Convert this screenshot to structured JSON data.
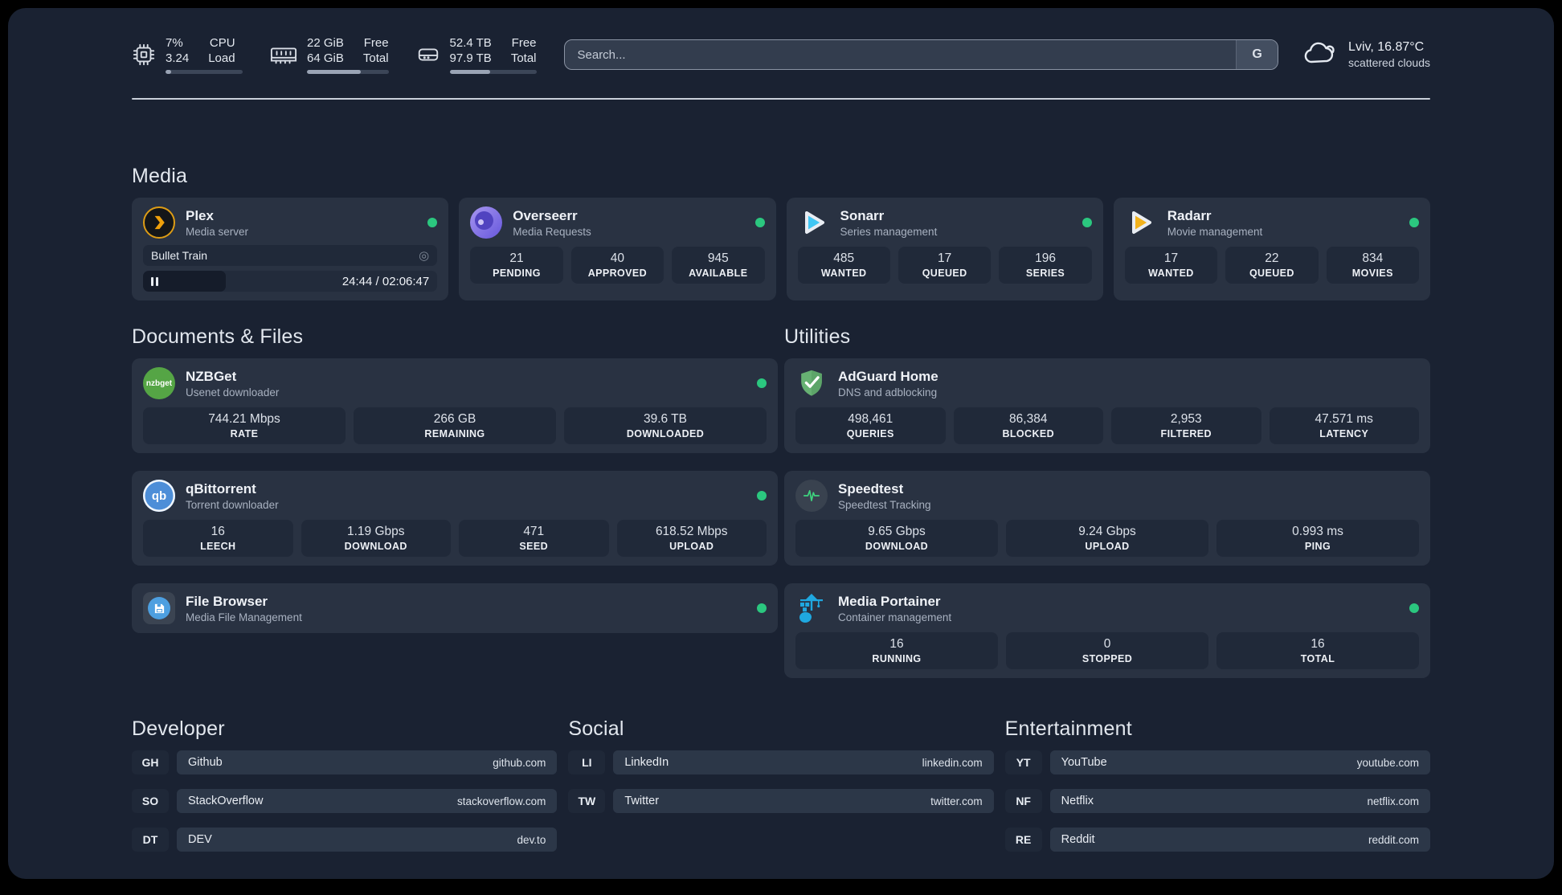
{
  "header": {
    "system_stats": [
      {
        "icon": "cpu-icon",
        "values": [
          "7%",
          "3.24"
        ],
        "labels": [
          "CPU",
          "Load"
        ],
        "progress_pct": 7
      },
      {
        "icon": "memory-icon",
        "values": [
          "22 GiB",
          "64 GiB"
        ],
        "labels": [
          "Free",
          "Total"
        ],
        "progress_pct": 66
      },
      {
        "icon": "disk-icon",
        "values": [
          "52.4 TB",
          "97.9 TB"
        ],
        "labels": [
          "Free",
          "Total"
        ],
        "progress_pct": 47
      }
    ],
    "search": {
      "placeholder": "Search...",
      "engine_label": "G"
    },
    "weather": {
      "location": "Lviv, 16.87°C",
      "condition": "scattered clouds"
    }
  },
  "colors": {
    "status_online": "#2bc77f"
  },
  "media": {
    "title": "Media",
    "plex": {
      "name": "Plex",
      "subtitle": "Media server",
      "online": true,
      "now_playing": {
        "title": "Bullet Train",
        "time_display": "24:44 / 02:06:47",
        "progress_pct": 28
      }
    },
    "overseerr": {
      "name": "Overseerr",
      "subtitle": "Media Requests",
      "online": true,
      "stats": [
        {
          "value": "21",
          "label": "PENDING"
        },
        {
          "value": "40",
          "label": "APPROVED"
        },
        {
          "value": "945",
          "label": "AVAILABLE"
        }
      ]
    },
    "sonarr": {
      "name": "Sonarr",
      "subtitle": "Series management",
      "online": true,
      "stats": [
        {
          "value": "485",
          "label": "WANTED"
        },
        {
          "value": "17",
          "label": "QUEUED"
        },
        {
          "value": "196",
          "label": "SERIES"
        }
      ]
    },
    "radarr": {
      "name": "Radarr",
      "subtitle": "Movie management",
      "online": true,
      "stats": [
        {
          "value": "17",
          "label": "WANTED"
        },
        {
          "value": "22",
          "label": "QUEUED"
        },
        {
          "value": "834",
          "label": "MOVIES"
        }
      ]
    }
  },
  "documents": {
    "title": "Documents & Files",
    "nzbget": {
      "name": "NZBGet",
      "subtitle": "Usenet downloader",
      "online": true,
      "icon_text": "nzbget",
      "stats": [
        {
          "value": "744.21 Mbps",
          "label": "RATE"
        },
        {
          "value": "266 GB",
          "label": "REMAINING"
        },
        {
          "value": "39.6 TB",
          "label": "DOWNLOADED"
        }
      ]
    },
    "qbittorrent": {
      "name": "qBittorrent",
      "subtitle": "Torrent downloader",
      "online": true,
      "icon_text": "qb",
      "stats": [
        {
          "value": "16",
          "label": "LEECH"
        },
        {
          "value": "1.19 Gbps",
          "label": "DOWNLOAD"
        },
        {
          "value": "471",
          "label": "SEED"
        },
        {
          "value": "618.52 Mbps",
          "label": "UPLOAD"
        }
      ]
    },
    "filebrowser": {
      "name": "File Browser",
      "subtitle": "Media File Management",
      "online": true
    }
  },
  "utilities": {
    "title": "Utilities",
    "adguard": {
      "name": "AdGuard Home",
      "subtitle": "DNS and adblocking",
      "online": false,
      "stats": [
        {
          "value": "498,461",
          "label": "QUERIES"
        },
        {
          "value": "86,384",
          "label": "BLOCKED"
        },
        {
          "value": "2,953",
          "label": "FILTERED"
        },
        {
          "value": "47.571 ms",
          "label": "LATENCY"
        }
      ]
    },
    "speedtest": {
      "name": "Speedtest",
      "subtitle": "Speedtest Tracking",
      "online": false,
      "stats": [
        {
          "value": "9.65 Gbps",
          "label": "DOWNLOAD"
        },
        {
          "value": "9.24 Gbps",
          "label": "UPLOAD"
        },
        {
          "value": "0.993 ms",
          "label": "PING"
        }
      ]
    },
    "portainer": {
      "name": "Media Portainer",
      "subtitle": "Container management",
      "online": true,
      "stats": [
        {
          "value": "16",
          "label": "RUNNING"
        },
        {
          "value": "0",
          "label": "STOPPED"
        },
        {
          "value": "16",
          "label": "TOTAL"
        }
      ]
    }
  },
  "bookmarks": [
    {
      "title": "Developer",
      "links": [
        {
          "abbr": "GH",
          "name": "Github",
          "url": "github.com"
        },
        {
          "abbr": "SO",
          "name": "StackOverflow",
          "url": "stackoverflow.com"
        },
        {
          "abbr": "DT",
          "name": "DEV",
          "url": "dev.to"
        }
      ]
    },
    {
      "title": "Social",
      "links": [
        {
          "abbr": "LI",
          "name": "LinkedIn",
          "url": "linkedin.com"
        },
        {
          "abbr": "TW",
          "name": "Twitter",
          "url": "twitter.com"
        }
      ]
    },
    {
      "title": "Entertainment",
      "links": [
        {
          "abbr": "YT",
          "name": "YouTube",
          "url": "youtube.com"
        },
        {
          "abbr": "NF",
          "name": "Netflix",
          "url": "netflix.com"
        },
        {
          "abbr": "RE",
          "name": "Reddit",
          "url": "reddit.com"
        }
      ]
    }
  ]
}
